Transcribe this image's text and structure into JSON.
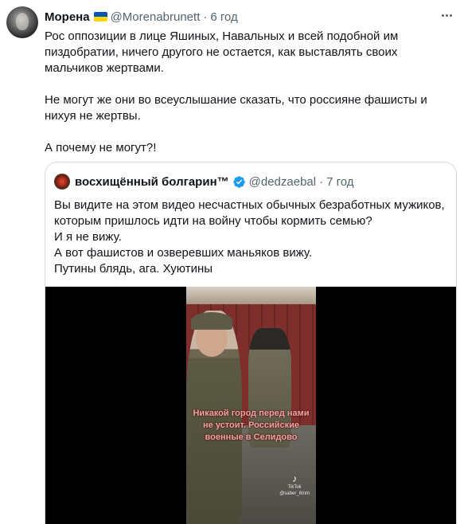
{
  "tweet": {
    "author_name": "Морена",
    "handle": "@Morenabrunett",
    "separator": "·",
    "time": "6 год",
    "paragraphs": [
      "Рос оппозиции в лице Яшиных, Навальных и всей подобной им пиздобратии, ничего другого не остается, как выставлять своих мальчиков жертвами.",
      "Не могут же они во всеуслышание сказать, что россияне фашисты и нихуя не жертвы.",
      "А почему не могут?!"
    ]
  },
  "quote": {
    "author_name": "восхищённый болгарин™",
    "handle": "@dedzaebal",
    "separator": "·",
    "time": "7 год",
    "lines": [
      "Вы видите на этом видео несчастных обычных безработных мужиков, которым пришлось идти на войну чтобы кормить семью?",
      "И я не вижу.",
      "А вот фашистов и озверевших маньяков вижу.",
      "Путины блядь, ага. Хуютины"
    ],
    "video": {
      "caption": "Никакой город перед нами не устоит. Российские военные в Селидово",
      "watermark_brand": "TikTok",
      "watermark_user": "@saber_6tnm"
    }
  },
  "icons": {
    "more": "more-horizontal-icon",
    "flag": "ukraine-flag-icon",
    "verified": "verified-badge-icon"
  },
  "colors": {
    "text_primary": "#0f1419",
    "text_secondary": "#536471",
    "border": "#cfd9de",
    "verified_blue": "#1d9bf0",
    "caption_pink": "#e8a3a0"
  }
}
